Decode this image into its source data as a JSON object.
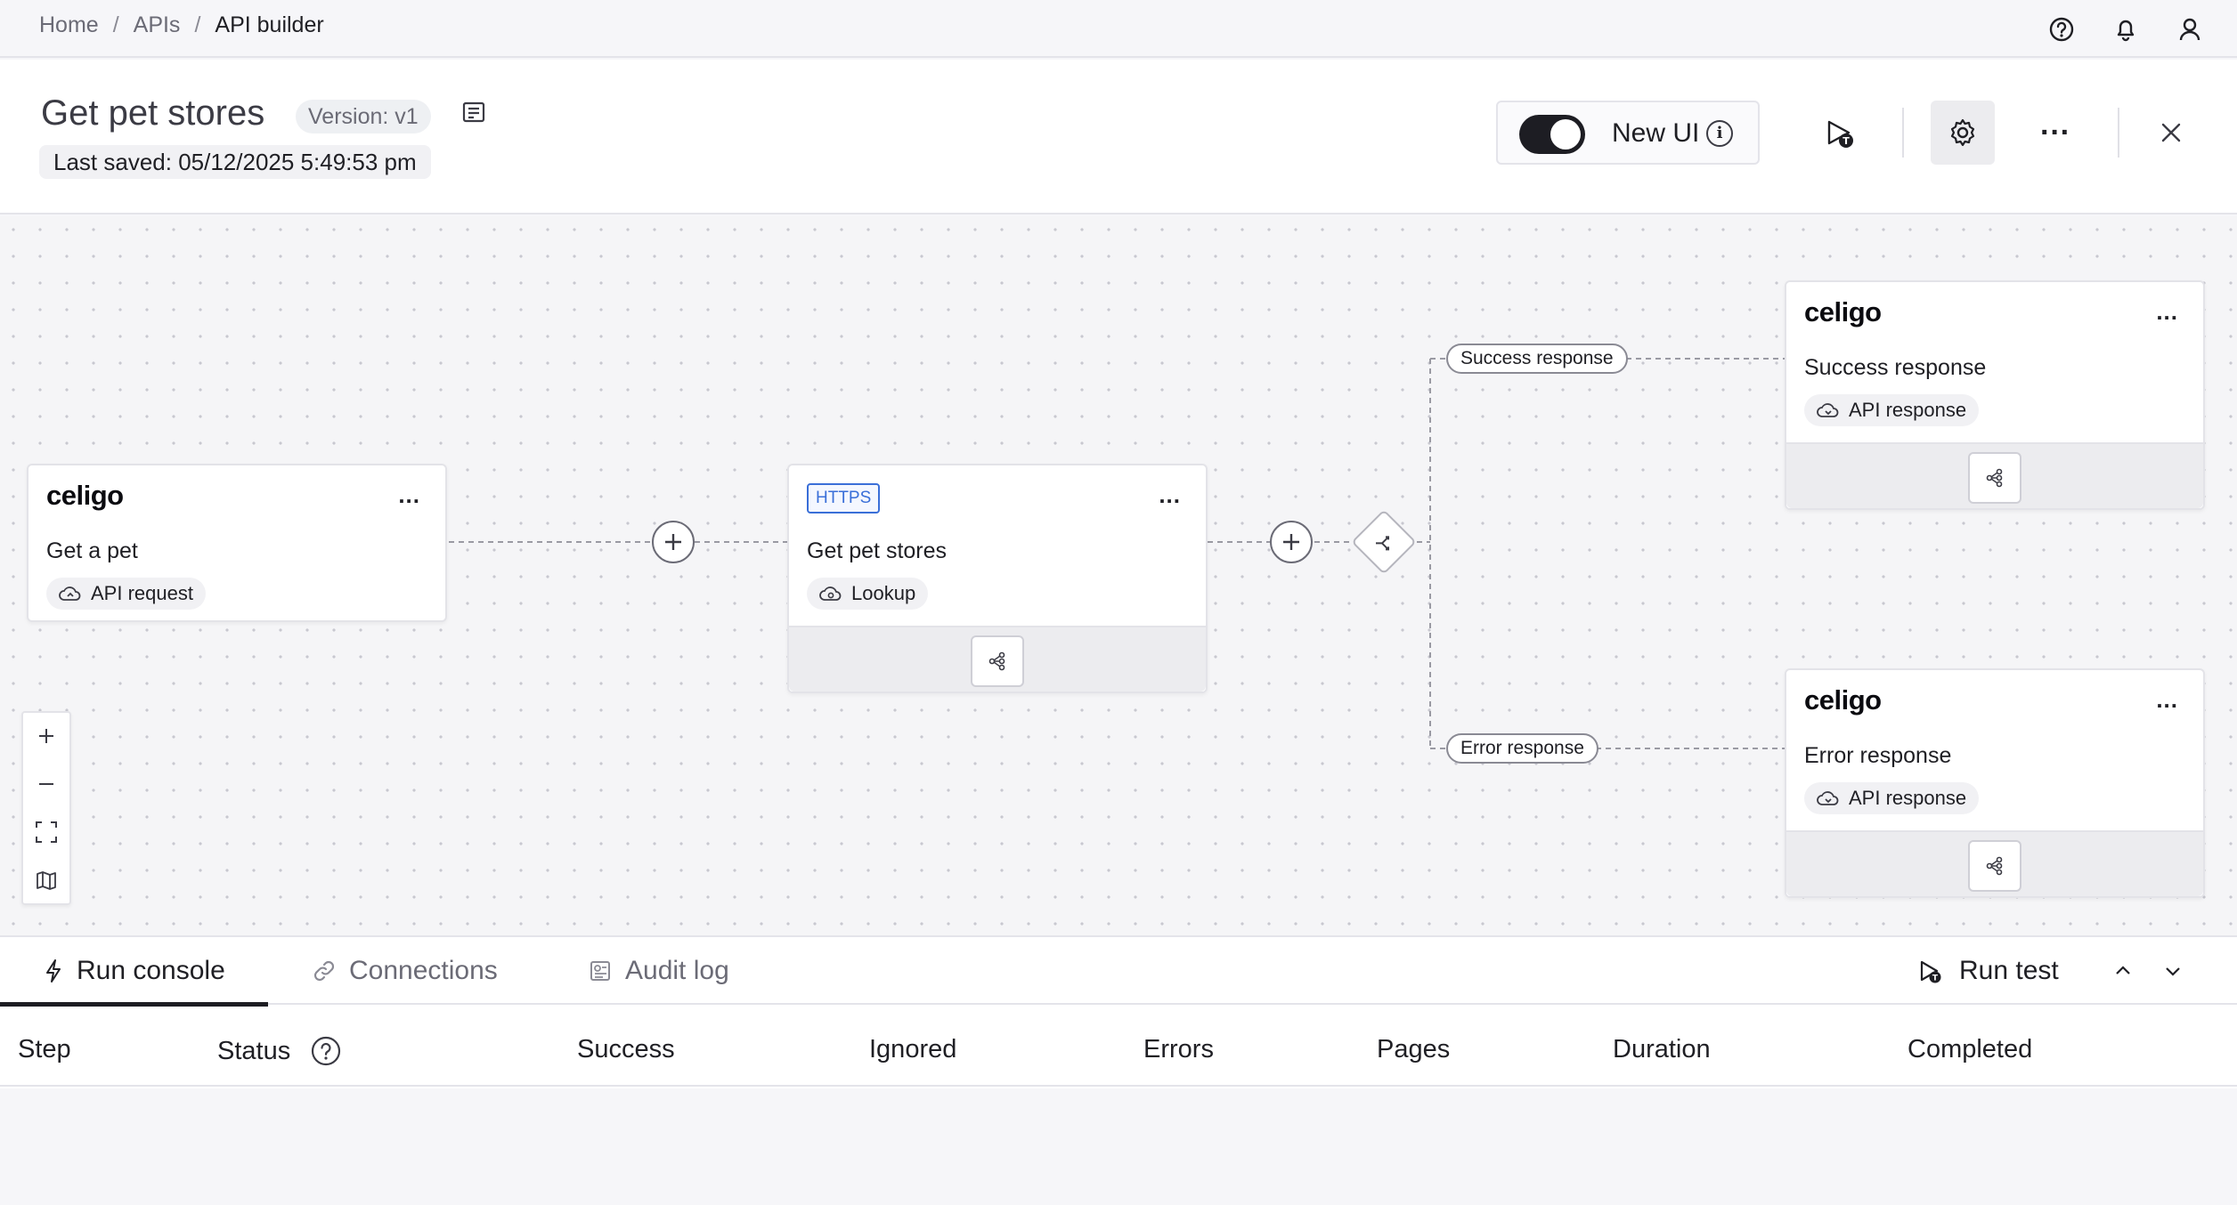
{
  "breadcrumb": {
    "home": "Home",
    "apis": "APIs",
    "current": "API builder",
    "separator": "/"
  },
  "header": {
    "title": "Get pet stores",
    "version": "Version: v1",
    "last_saved": "Last saved: 05/12/2025 5:49:53 pm",
    "toggle_label": "New UI",
    "toggle_on": true,
    "info_glyph": "i",
    "more_glyph": "···"
  },
  "canvas": {
    "nodes": [
      {
        "id": "get-a-pet",
        "logo": "celigo",
        "name": "Get a pet",
        "tag": "API request",
        "menu": "..."
      },
      {
        "id": "get-pet-stores",
        "badge": "HTTPS",
        "name": "Get pet stores",
        "tag": "Lookup",
        "menu": "..."
      },
      {
        "id": "success-response",
        "logo": "celigo",
        "name": "Success response",
        "tag": "API response",
        "menu": "..."
      },
      {
        "id": "error-response",
        "logo": "celigo",
        "name": "Error response",
        "tag": "API response",
        "menu": "..."
      }
    ],
    "edges": {
      "success_label": "Success response",
      "error_label": "Error response"
    }
  },
  "bottom": {
    "tabs": [
      {
        "label": "Run console",
        "active": true
      },
      {
        "label": "Connections",
        "active": false
      },
      {
        "label": "Audit log",
        "active": false
      }
    ],
    "run_test": "Run test",
    "columns": [
      "Step",
      "Status",
      "Success",
      "Ignored",
      "Errors",
      "Pages",
      "Duration",
      "Completed"
    ]
  },
  "colors": {
    "accent": "#1d1d23",
    "https_blue": "#3a6fd8",
    "canvas_bg": "#f5f5f7"
  },
  "icons": [
    "help-icon",
    "bell-icon",
    "user-icon",
    "notes-icon",
    "run-test-icon",
    "gear-icon",
    "more-icon",
    "close-icon",
    "cloud-icon",
    "branch-icon",
    "plus-icon",
    "router-icon",
    "zoom-in-icon",
    "zoom-out-icon",
    "fit-view-icon",
    "map-icon",
    "lightning-icon",
    "link-icon",
    "audit-icon",
    "chevron-up-icon",
    "chevron-down-icon"
  ]
}
